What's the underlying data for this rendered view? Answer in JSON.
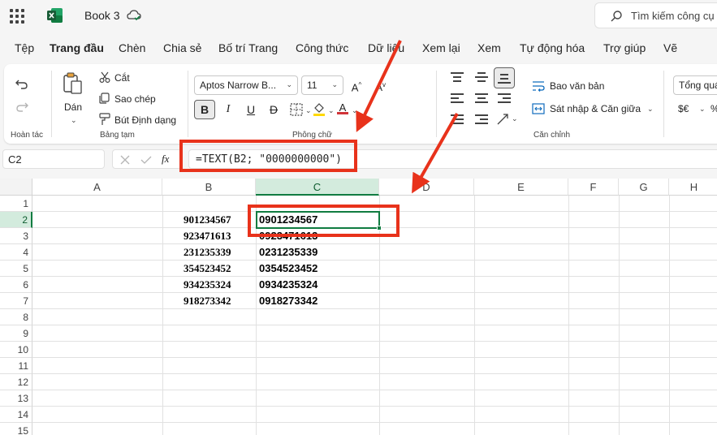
{
  "titlebar": {
    "app_icon": "excel-logo-icon",
    "book_title": "Book 3",
    "sync_icon": "cloud-check-icon",
    "search_placeholder": "Tìm kiếm công cụ"
  },
  "menu": {
    "tabs": [
      "Tệp",
      "Trang đầu",
      "Chèn",
      "Chia sẻ",
      "Bố trí Trang",
      "Công thức",
      "Dữ liệu",
      "Xem lại",
      "Xem",
      "Tự động hóa",
      "Trợ giúp",
      "Vẽ"
    ],
    "active_tab": "Trang đầu"
  },
  "ribbon": {
    "undo_group": "Hoàn tác",
    "clipboard": {
      "paste": "Dán",
      "cut": "Cắt",
      "copy": "Sao chép",
      "format_painter": "Bút Định dạng",
      "group": "Bảng tạm"
    },
    "font": {
      "name": "Aptos Narrow B...",
      "size": "11",
      "bold": "B",
      "italic": "I",
      "underline": "U",
      "strike": "D",
      "group": "Phông chữ",
      "font_color": "#d13438"
    },
    "alignment": {
      "wrap": "Bao văn bản",
      "merge": "Sát nhập & Căn giữa",
      "group": "Căn chỉnh"
    },
    "number": {
      "format": "Tổng quát",
      "currency": "$€"
    }
  },
  "formula_bar": {
    "cell_ref": "C2",
    "fx": "fx",
    "formula": "=TEXT(B2; \"0000000000\")"
  },
  "grid": {
    "columns": [
      "A",
      "B",
      "C",
      "D",
      "E",
      "F",
      "G",
      "H"
    ],
    "selected_column": "C",
    "rows": [
      "1",
      "2",
      "3",
      "4",
      "5",
      "6",
      "7",
      "8",
      "9",
      "10",
      "11",
      "12",
      "13",
      "14",
      "15"
    ],
    "selected_row": "2",
    "col_b_values": [
      "901234567",
      "923471613",
      "231235339",
      "354523452",
      "934235324",
      "918273342"
    ],
    "col_c_values": [
      "0901234567",
      "0923471613",
      "0231235339",
      "0354523452",
      "0934235324",
      "0918273342"
    ]
  },
  "colors": {
    "accent_green": "#107c41",
    "header_selected": "#d3ebdd",
    "annotation_red": "#e8321b"
  }
}
